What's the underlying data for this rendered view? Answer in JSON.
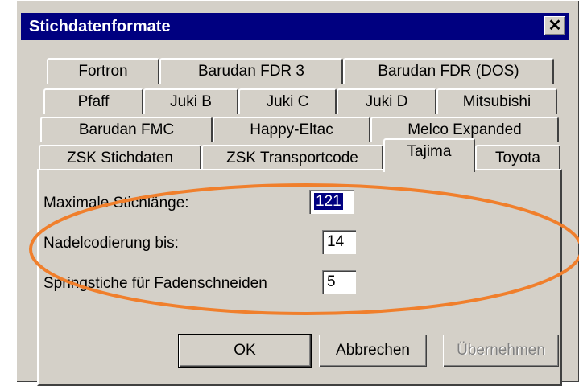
{
  "window": {
    "title": "Stichdatenformate"
  },
  "icons": {
    "close": "close-icon"
  },
  "tabs": {
    "row1": [
      "Fortron",
      "Barudan FDR 3",
      "Barudan FDR (DOS)"
    ],
    "row2": [
      "Pfaff",
      "Juki B",
      "Juki C",
      "Juki D",
      "Mitsubishi"
    ],
    "row3": [
      "Barudan FMC",
      "Happy-Eltac",
      "Melco Expanded"
    ],
    "row4": [
      "ZSK Stichdaten",
      "ZSK Transportcode",
      "Tajima",
      "Toyota"
    ],
    "active": "Tajima"
  },
  "settings": {
    "max_stitch_length": {
      "label": "Maximale Stichlänge:",
      "value": "121"
    },
    "needle_coding": {
      "label": "Nadelcodierung bis:",
      "value": "14"
    },
    "jump_stitches": {
      "label": "Springstiche für Fadenschneiden",
      "value": "5"
    }
  },
  "buttons": {
    "ok": "OK",
    "cancel": "Abbrechen",
    "apply": "Übernehmen"
  },
  "annotation": {
    "ellipse_color": "#f07f2c"
  }
}
